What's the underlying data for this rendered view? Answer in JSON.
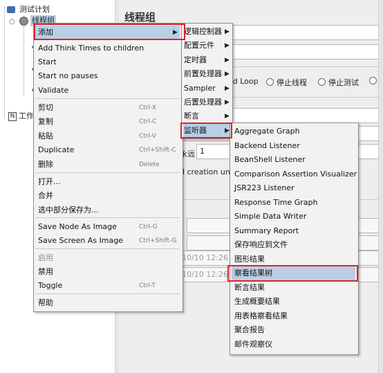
{
  "tree": {
    "test_plan": "测试计划",
    "thread_group": "线程组",
    "workbench_partial": "工作"
  },
  "panel": {
    "title": "线程组",
    "loop_label": "ad Loop",
    "stop_thread": "停止线程",
    "stop_test": "停止测试",
    "stop_more": "S",
    "forever_label": "永远",
    "loop_count": "1",
    "delay_creation": "d creation unt",
    "start_time_partial": "10/10 12:26 1",
    "end_time_partial": "10/10 12:26 1"
  },
  "context_menu": {
    "items": [
      {
        "label": "添加",
        "shortcut": "",
        "has_submenu": true,
        "selected": true
      },
      {
        "label": "Add Think Times to children",
        "shortcut": ""
      },
      {
        "label": "Start",
        "shortcut": ""
      },
      {
        "label": "Start no pauses",
        "shortcut": ""
      },
      {
        "label": "Validate",
        "shortcut": ""
      },
      {
        "label": "剪切",
        "shortcut": "Ctrl-X"
      },
      {
        "label": "复制",
        "shortcut": "Ctrl-C"
      },
      {
        "label": "粘贴",
        "shortcut": "Ctrl-V"
      },
      {
        "label": "Duplicate",
        "shortcut": "Ctrl+Shift-C"
      },
      {
        "label": "删除",
        "shortcut": "Delete"
      },
      {
        "label": "打开...",
        "shortcut": ""
      },
      {
        "label": "合并",
        "shortcut": ""
      },
      {
        "label": "选中部分保存为...",
        "shortcut": ""
      },
      {
        "label": "Save Node As Image",
        "shortcut": "Ctrl-G"
      },
      {
        "label": "Save Screen As Image",
        "shortcut": "Ctrl+Shift-G"
      },
      {
        "label": "启用",
        "shortcut": "",
        "disabled": true
      },
      {
        "label": "禁用",
        "shortcut": ""
      },
      {
        "label": "Toggle",
        "shortcut": "Ctrl-T"
      },
      {
        "label": "帮助",
        "shortcut": ""
      }
    ]
  },
  "add_submenu": {
    "items": [
      {
        "label": "逻辑控制器"
      },
      {
        "label": "配置元件"
      },
      {
        "label": "定时器"
      },
      {
        "label": "前置处理器"
      },
      {
        "label": "Sampler"
      },
      {
        "label": "后置处理器"
      },
      {
        "label": "断言"
      },
      {
        "label": "监听器",
        "selected": true
      }
    ]
  },
  "listener_submenu": {
    "items": [
      {
        "label": "Aggregate Graph"
      },
      {
        "label": "Backend Listener"
      },
      {
        "label": "BeanShell Listener"
      },
      {
        "label": "Comparison Assertion Visualizer"
      },
      {
        "label": "JSR223 Listener"
      },
      {
        "label": "Response Time Graph"
      },
      {
        "label": "Simple Data Writer"
      },
      {
        "label": "Summary Report"
      },
      {
        "label": "保存响应到文件"
      },
      {
        "label": "图形结果"
      },
      {
        "label": "察看结果树",
        "selected": true
      },
      {
        "label": "断言结果"
      },
      {
        "label": "生成概要结果"
      },
      {
        "label": "用表格察看结果"
      },
      {
        "label": "聚合报告"
      },
      {
        "label": "邮件观察仪"
      }
    ]
  },
  "colors": {
    "selection": "#b8cfe5",
    "highlight_box": "#e0212b",
    "menu_bg": "#f2f2f2"
  }
}
